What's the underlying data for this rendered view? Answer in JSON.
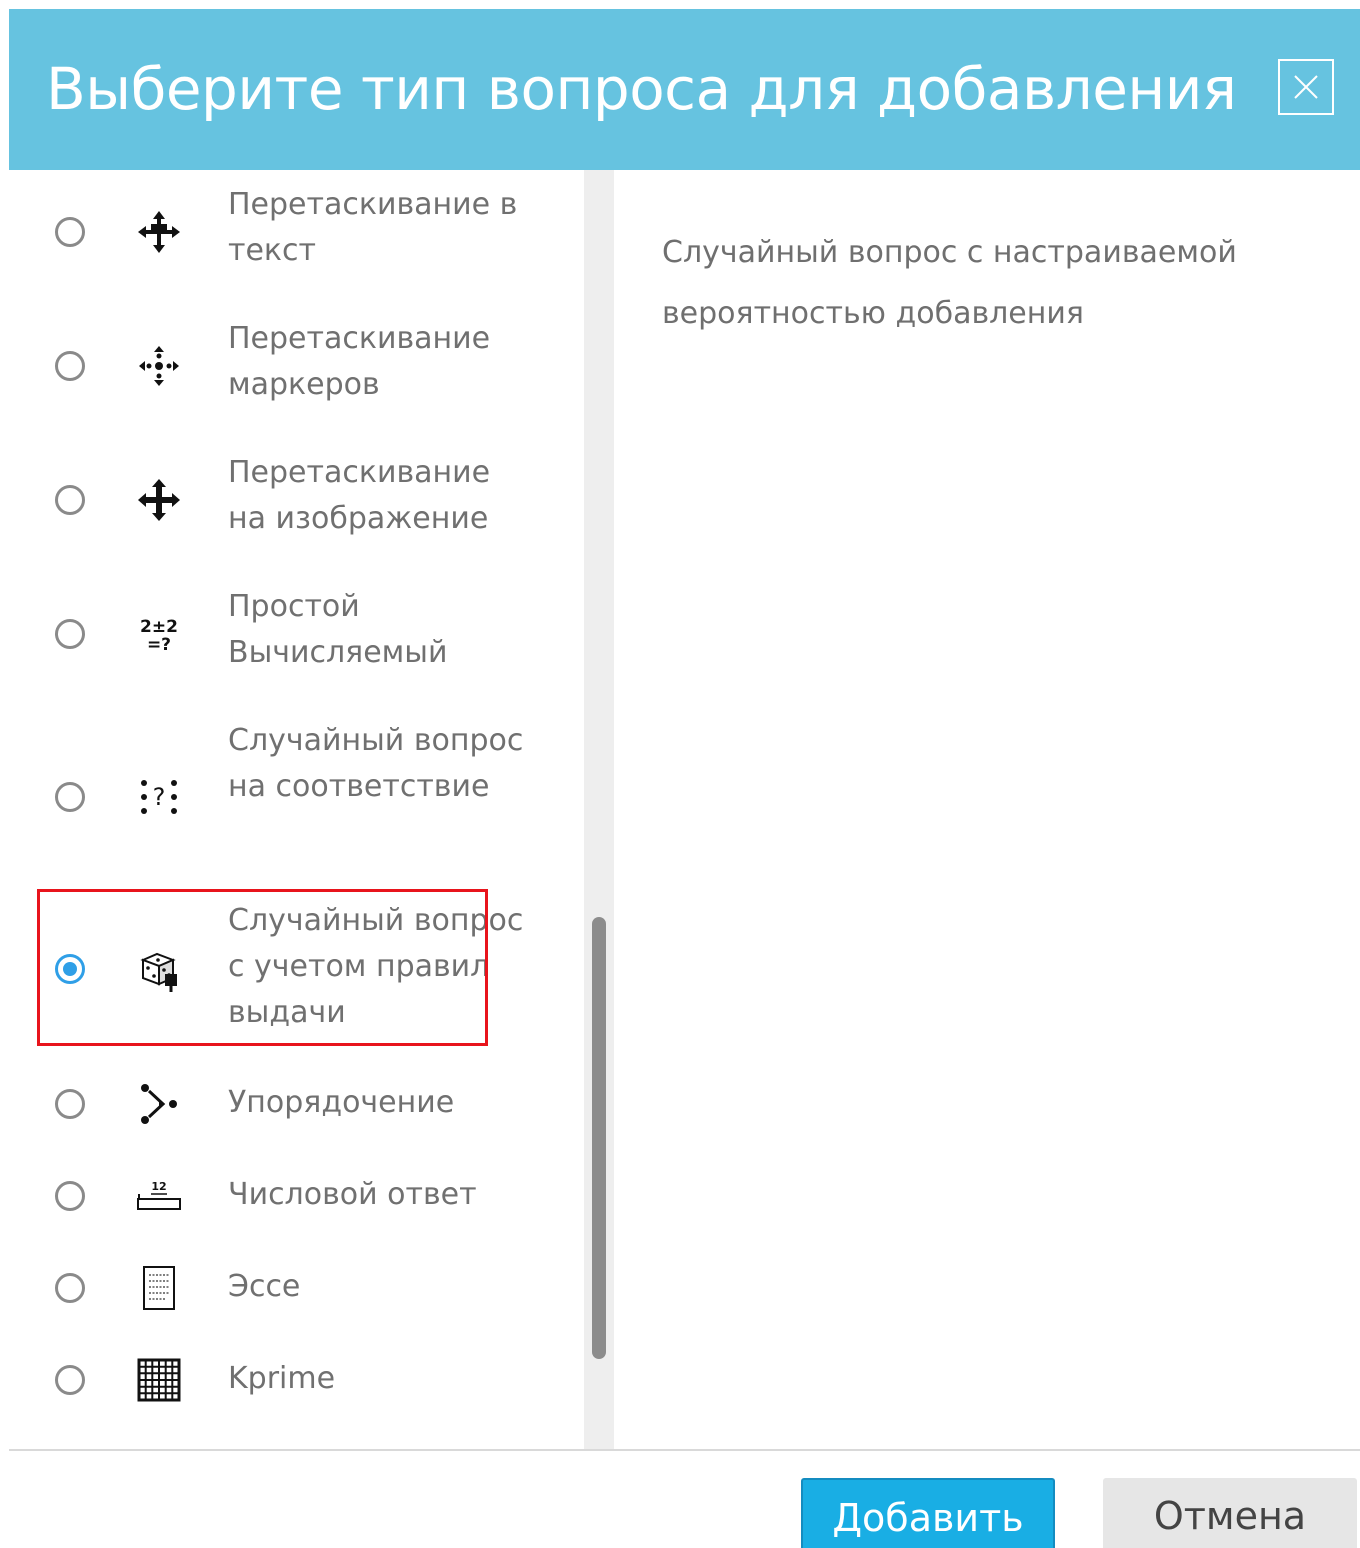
{
  "dialog": {
    "title": "Выберите тип вопроса для добавления",
    "close_icon": "close-icon",
    "header_color": "#66c3e0"
  },
  "options": [
    {
      "label": "Перетаскивание в текст",
      "icon": "drag-text-icon",
      "selected": false
    },
    {
      "label": "Перетаскивание маркеров",
      "icon": "drag-markers-icon",
      "selected": false
    },
    {
      "label": "Перетаскивание на изображение",
      "icon": "drag-image-icon",
      "selected": false
    },
    {
      "label": "Простой Вычисляемый",
      "icon": "calculated-simple-icon",
      "selected": false
    },
    {
      "label": "Случайный вопрос на соответствие",
      "icon": "random-match-icon",
      "selected": false
    },
    {
      "label": "Случайный вопрос с учетом правил выдачи",
      "icon": "dice-icon",
      "selected": true
    },
    {
      "label": "Упорядочение",
      "icon": "ordering-icon",
      "selected": false
    },
    {
      "label": "Числовой ответ",
      "icon": "numerical-icon",
      "selected": false
    },
    {
      "label": "Эссе",
      "icon": "essay-icon",
      "selected": false
    },
    {
      "label": "Kprime",
      "icon": "grid-icon",
      "selected": false
    }
  ],
  "description": "Случайный вопрос с настраиваемой вероятностью добавления",
  "buttons": {
    "add_label": "Добавить",
    "cancel_label": "Отмена"
  },
  "colors": {
    "accent": "#19aee4",
    "radio_selected": "#2f9fe7",
    "highlight": "#e8141c"
  }
}
